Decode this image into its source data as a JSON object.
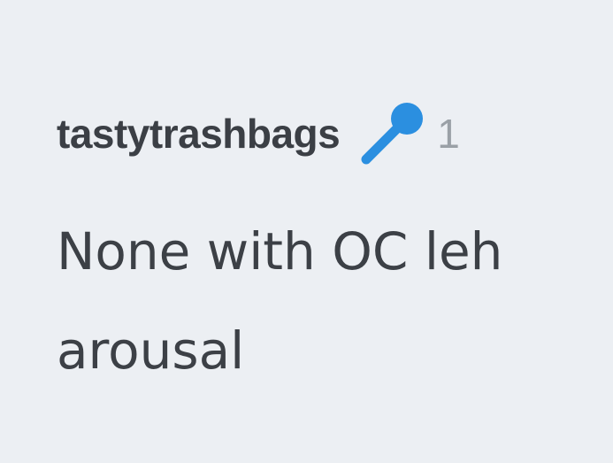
{
  "comment": {
    "username": "tastytrashbags",
    "badge_icon": "microphone-icon",
    "badge_color": "#2b8fe0",
    "timestamp": "1",
    "body_lines": [
      "None with OC leh",
      "arousal"
    ]
  }
}
